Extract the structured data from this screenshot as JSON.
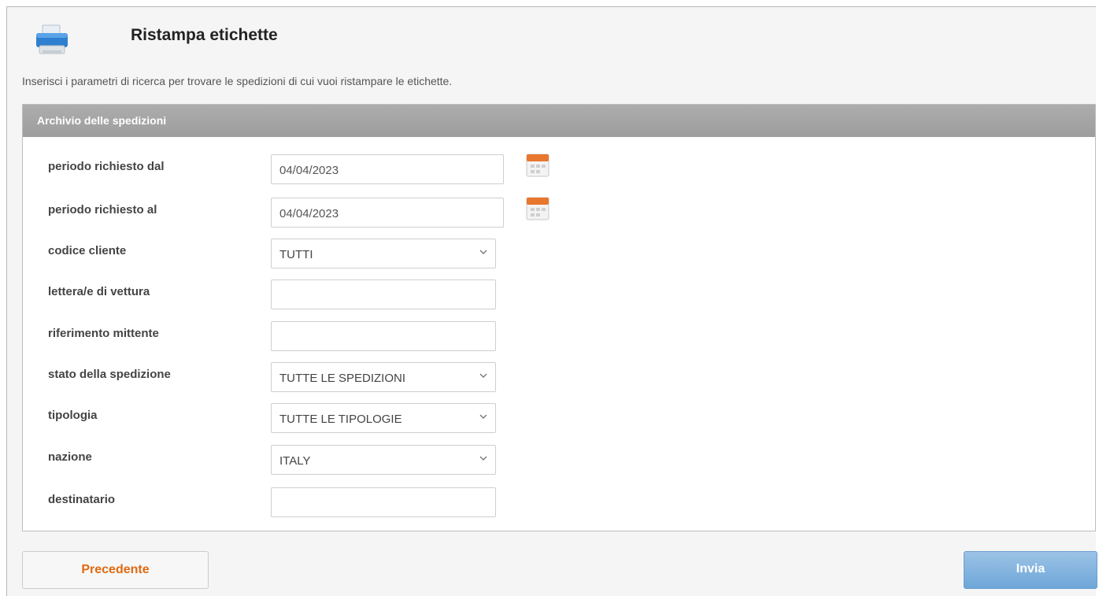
{
  "header": {
    "title": "Ristampa etichette",
    "icon": "printer-icon"
  },
  "intro_text": "Inserisci i parametri di ricerca per trovare le spedizioni di cui vuoi ristampare le etichette.",
  "panel": {
    "title": "Archivio delle spedizioni"
  },
  "form": {
    "date_from": {
      "label": "periodo richiesto dal",
      "value": "04/04/2023",
      "icon": "calendar-icon"
    },
    "date_to": {
      "label": "periodo richiesto al",
      "value": "04/04/2023",
      "icon": "calendar-icon"
    },
    "customer_code": {
      "label": "codice cliente",
      "value": "TUTTI"
    },
    "waybill": {
      "label": "lettera/e di vettura",
      "value": ""
    },
    "sender_ref": {
      "label": "riferimento mittente",
      "value": ""
    },
    "shipment_status": {
      "label": "stato della spedizione",
      "value": "TUTTE LE SPEDIZIONI"
    },
    "type": {
      "label": "tipologia",
      "value": "TUTTE LE TIPOLOGIE"
    },
    "country": {
      "label": "nazione",
      "value": "ITALY"
    },
    "recipient": {
      "label": "destinatario",
      "value": ""
    }
  },
  "buttons": {
    "previous": "Precedente",
    "send": "Invia"
  },
  "colors": {
    "panel_header": "#a5a5a5",
    "previous_text": "#e06a10",
    "send_button": "#7fb2de"
  }
}
